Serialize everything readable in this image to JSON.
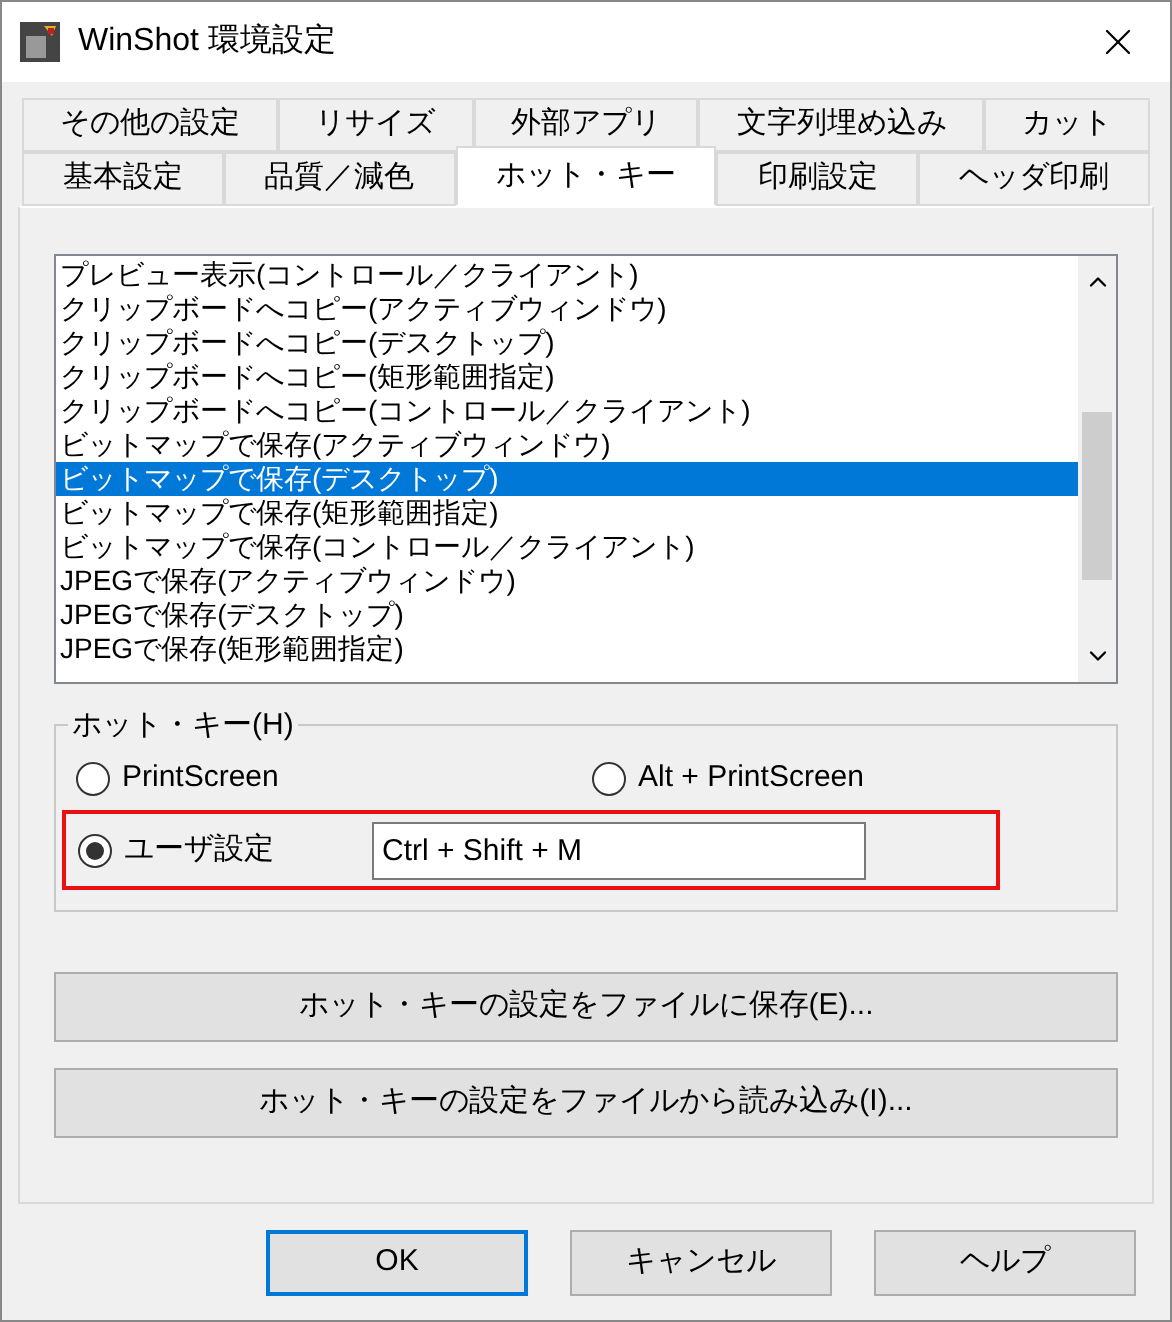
{
  "window": {
    "title": "WinShot 環境設定"
  },
  "tab_rows": [
    [
      {
        "label": "その他の設定",
        "selected": false
      },
      {
        "label": "リサイズ",
        "selected": false
      },
      {
        "label": "外部アプリ",
        "selected": false
      },
      {
        "label": "文字列埋め込み",
        "selected": false
      },
      {
        "label": "カット",
        "selected": false
      }
    ],
    [
      {
        "label": "基本設定",
        "selected": false
      },
      {
        "label": "品質／減色",
        "selected": false
      },
      {
        "label": "ホット・キー",
        "selected": true
      },
      {
        "label": "印刷設定",
        "selected": false
      },
      {
        "label": "ヘッダ印刷",
        "selected": false
      }
    ]
  ],
  "action_list": [
    {
      "label": "プレビュー表示(コントロール／クライアント)",
      "selected": false
    },
    {
      "label": "クリップボードへコピー(アクティブウィンドウ)",
      "selected": false
    },
    {
      "label": "クリップボードへコピー(デスクトップ)",
      "selected": false
    },
    {
      "label": "クリップボードへコピー(矩形範囲指定)",
      "selected": false
    },
    {
      "label": "クリップボードへコピー(コントロール／クライアント)",
      "selected": false
    },
    {
      "label": "ビットマップで保存(アクティブウィンドウ)",
      "selected": false
    },
    {
      "label": "ビットマップで保存(デスクトップ)",
      "selected": true
    },
    {
      "label": "ビットマップで保存(矩形範囲指定)",
      "selected": false
    },
    {
      "label": "ビットマップで保存(コントロール／クライアント)",
      "selected": false
    },
    {
      "label": "JPEGで保存(アクティブウィンドウ)",
      "selected": false
    },
    {
      "label": "JPEGで保存(デスクトップ)",
      "selected": false
    },
    {
      "label": "JPEGで保存(矩形範囲指定)",
      "selected": false
    }
  ],
  "hotkey_group": {
    "legend": "ホット・キー(H)",
    "highlight_custom_row": true,
    "options": [
      {
        "label": "PrintScreen",
        "selected": false
      },
      {
        "label": "Alt + PrintScreen",
        "selected": false
      },
      {
        "label": "ユーザ設定",
        "selected": true,
        "value": "Ctrl + Shift + M"
      }
    ]
  },
  "file_buttons": [
    "ホット・キーの設定をファイルに保存(E)...",
    "ホット・キーの設定をファイルから読み込み(I)..."
  ],
  "dialog_buttons": [
    {
      "label": "OK",
      "default": true
    },
    {
      "label": "キャンセル",
      "default": false
    },
    {
      "label": "ヘルプ",
      "default": false
    }
  ]
}
